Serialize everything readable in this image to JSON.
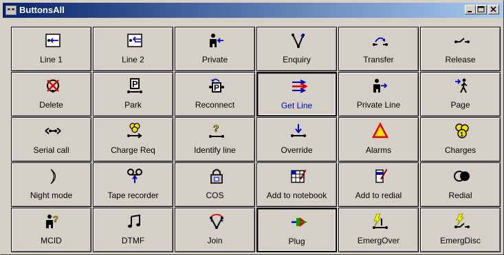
{
  "window": {
    "title": "ButtonsAll"
  },
  "buttons": [
    {
      "label": "Line 1",
      "icon": "line-1-icon"
    },
    {
      "label": "Line 2",
      "icon": "line-2-icon"
    },
    {
      "label": "Private",
      "icon": "private-icon"
    },
    {
      "label": "Enquiry",
      "icon": "enquiry-icon"
    },
    {
      "label": "Transfer",
      "icon": "transfer-icon"
    },
    {
      "label": "Release",
      "icon": "release-icon"
    },
    {
      "label": "Delete",
      "icon": "delete-icon"
    },
    {
      "label": "Park",
      "icon": "park-icon"
    },
    {
      "label": "Reconnect",
      "icon": "reconnect-icon"
    },
    {
      "label": "Get Line",
      "icon": "get-line-icon",
      "pressed": true,
      "color": "#0000c0"
    },
    {
      "label": "Private Line",
      "icon": "private-line-icon"
    },
    {
      "label": "Page",
      "icon": "page-icon"
    },
    {
      "label": "Serial call",
      "icon": "serial-call-icon"
    },
    {
      "label": "Charge Req",
      "icon": "charge-req-icon"
    },
    {
      "label": "Identify line",
      "icon": "identify-line-icon"
    },
    {
      "label": "Override",
      "icon": "override-icon"
    },
    {
      "label": "Alarms",
      "icon": "alarms-icon"
    },
    {
      "label": "Charges",
      "icon": "charges-icon"
    },
    {
      "label": "Night mode",
      "icon": "night-mode-icon"
    },
    {
      "label": "Tape recorder",
      "icon": "tape-recorder-icon"
    },
    {
      "label": "COS",
      "icon": "cos-lock-icon"
    },
    {
      "label": "Add to notebook",
      "icon": "add-to-notebook-icon"
    },
    {
      "label": "Add to redial",
      "icon": "add-to-redial-icon"
    },
    {
      "label": "Redial",
      "icon": "redial-icon"
    },
    {
      "label": "MCID",
      "icon": "mcid-icon"
    },
    {
      "label": "DTMF",
      "icon": "dtmf-icon"
    },
    {
      "label": "Join",
      "icon": "join-icon"
    },
    {
      "label": "Plug",
      "icon": "plug-icon",
      "pressed": true
    },
    {
      "label": "EmergOver",
      "icon": "emerg-over-icon"
    },
    {
      "label": "EmergDisc",
      "icon": "emerg-disc-icon"
    }
  ],
  "colors": {
    "accent_blue": "#0000c0",
    "titlebar_start": "#0a246a",
    "titlebar_end": "#a6caf0",
    "face": "#d4d0c8"
  }
}
